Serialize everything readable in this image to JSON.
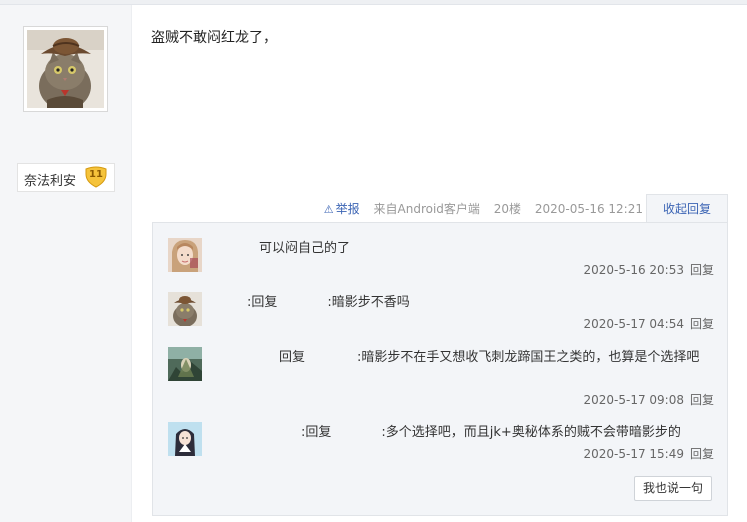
{
  "post": {
    "text": "盗贼不敢闷红龙了，",
    "author": {
      "name": "奈法利安",
      "level": "11",
      "avatar": "cowboy-cat-avatar"
    },
    "tail": {
      "report_label": "举报",
      "source": "来自Android客户端",
      "floor": "20楼",
      "datetime": "2020-05-16 12:21",
      "collapse_label": "收起回复"
    }
  },
  "replies": [
    {
      "avatar": "girl-avatar",
      "prefix": "",
      "reply_word": "",
      "body": "可以闷自己的了",
      "time": "2020-5-16 20:53",
      "reply_label": "回复"
    },
    {
      "avatar": "cowboy-cat-avatar",
      "prefix": ":",
      "reply_word": "回复",
      "body": ":暗影步不香吗",
      "time": "2020-5-17 04:54",
      "reply_label": "回复"
    },
    {
      "avatar": "warrior-avatar",
      "prefix": "",
      "reply_word": "回复",
      "body": ":暗影步不在手又想收飞刺龙蹄国王之类的，也算是个选择吧",
      "time": "2020-5-17 09:08",
      "reply_label": "回复"
    },
    {
      "avatar": "anime-girl-avatar",
      "prefix": ":",
      "reply_word": "回复",
      "body": ":多个选择吧，而且jk+奥秘体系的贼不会带暗影步的",
      "time": "2020-5-17 15:49",
      "reply_label": "回复"
    }
  ],
  "say_button_label": "我也说一句",
  "colors": {
    "link": "#3b64b4",
    "panel_bg": "#f3f5f8",
    "badge": "#f5c33b"
  }
}
